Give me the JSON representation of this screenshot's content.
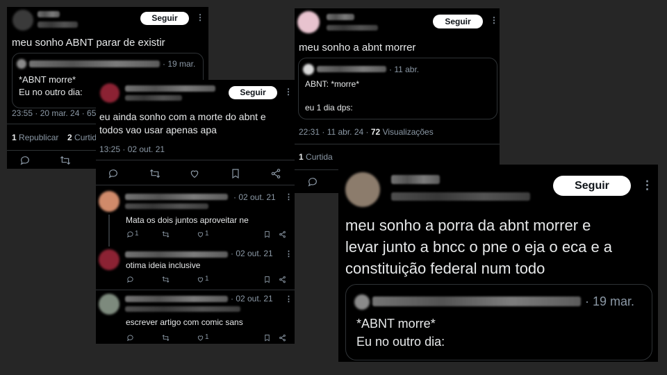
{
  "card1": {
    "follow_label": "Seguir",
    "tweet_text": "meu sonho ABNT parar de existir",
    "quote_date": "· 19 mar.",
    "quote_line1": "*ABNT morre*",
    "quote_line2": "Eu no outro dia:",
    "meta": "23:55 · 20 mar. 24 · 65",
    "reposts_count": "1",
    "reposts_label": "Republicar",
    "likes_count": "2",
    "likes_label": "Curtid"
  },
  "card2": {
    "follow_label": "Seguir",
    "tweet_text_line1": "eu ainda sonho com a morte do abnt e",
    "tweet_text_line2": "todos vao usar apenas apa",
    "meta": "13:25 · 02 out. 21",
    "replies": [
      {
        "date": "· 02 out. 21",
        "text": "Mata os dois juntos aproveitar ne",
        "reply_count": "1",
        "like_count": "1"
      },
      {
        "date": "· 02 out. 21",
        "text": "otima ideia inclusive",
        "like_count": "1"
      },
      {
        "date": "· 02 out. 21",
        "text": "escrever artigo com comic sans",
        "like_count": "1"
      }
    ]
  },
  "card3": {
    "follow_label": "Seguir",
    "tweet_text": "meu sonho a abnt morrer",
    "quote_date": "· 11 abr.",
    "quote_line1": "ABNT: *morre*",
    "quote_line2": "eu 1 dia dps:",
    "meta_time": "22:31 · 11 abr. 24 ·",
    "views_count": "72",
    "views_label": "Visualizações",
    "likes_count": "1",
    "likes_label": "Curtida"
  },
  "card4": {
    "follow_label": "Seguir",
    "tweet_text_line1": "meu sonho a porra da abnt morrer e",
    "tweet_text_line2": "levar junto a bncc o pne o eja o eca e a",
    "tweet_text_line3": "constituição federal num todo",
    "quote_date": "· 19 mar.",
    "quote_line1": "*ABNT morre*",
    "quote_line2": "Eu no outro dia:"
  }
}
